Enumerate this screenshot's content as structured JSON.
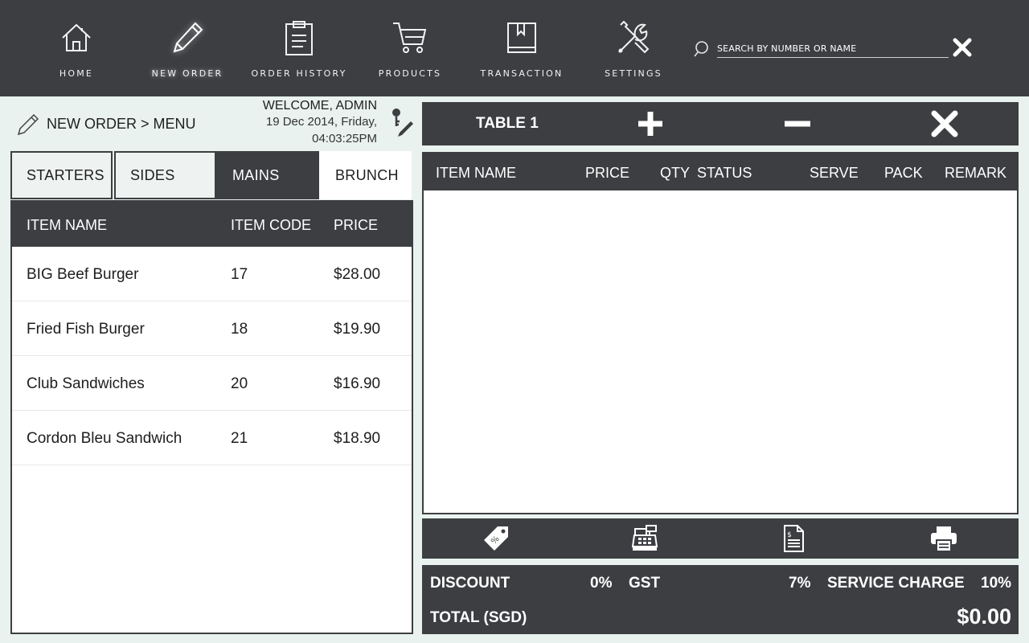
{
  "nav": {
    "items": [
      {
        "label": "HOME",
        "icon": "home-icon"
      },
      {
        "label": "NEW ORDER",
        "icon": "pencil-icon"
      },
      {
        "label": "ORDER HISTORY",
        "icon": "clipboard-icon"
      },
      {
        "label": "PRODUCTS",
        "icon": "cart-icon"
      },
      {
        "label": "TRANSACTION",
        "icon": "book-icon"
      },
      {
        "label": "SETTINGS",
        "icon": "tools-icon"
      }
    ],
    "active": "NEW ORDER"
  },
  "search": {
    "placeholder": "SEARCH BY NUMBER OR NAME",
    "value": ""
  },
  "breadcrumb": {
    "text": "NEW ORDER > MENU"
  },
  "welcome": {
    "line1": "WELCOME, ADMIN",
    "line2": "19 Dec 2014, Friday,",
    "line3": "04:03:25PM"
  },
  "tabs": [
    {
      "label": "STARTERS"
    },
    {
      "label": "SIDES"
    },
    {
      "label": "MAINS"
    },
    {
      "label": "BRUNCH"
    }
  ],
  "active_tab": "MAINS",
  "menu_table": {
    "headers": [
      "ITEM NAME",
      "ITEM CODE",
      "PRICE"
    ],
    "rows": [
      {
        "name": "BIG Beef Burger",
        "code": "17",
        "price": "$28.00"
      },
      {
        "name": "Fried Fish Burger",
        "code": "18",
        "price": "$19.90"
      },
      {
        "name": "Club Sandwiches",
        "code": "20",
        "price": "$16.90"
      },
      {
        "name": "Cordon Bleu Sandwich",
        "code": "21",
        "price": "$18.90"
      }
    ]
  },
  "order": {
    "table_title": "TABLE 1",
    "headers": [
      "ITEM NAME",
      "PRICE",
      "QTY",
      "STATUS",
      "SERVE",
      "PACK",
      "REMARK"
    ],
    "items": []
  },
  "actions": [
    "discount-tag-icon",
    "cash-register-icon",
    "invoice-icon",
    "printer-icon"
  ],
  "summary": {
    "discount_label": "DISCOUNT",
    "discount_value": "0%",
    "gst_label": "GST",
    "gst_value": "7%",
    "service_label": "SERVICE CHARGE",
    "service_value": "10%",
    "total_label": "TOTAL (SGD)",
    "total_value": "$0.00"
  },
  "colors": {
    "dark": "#3d3e42",
    "background": "#e9f2ee",
    "white": "#ffffff"
  }
}
